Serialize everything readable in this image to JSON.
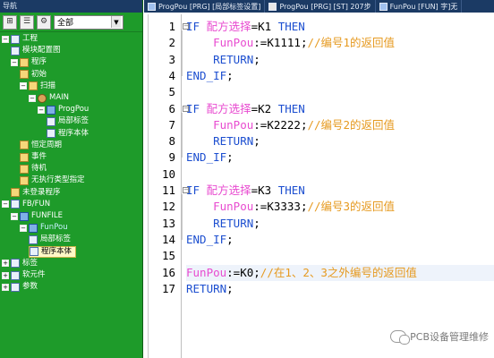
{
  "nav": {
    "title": "导航",
    "toolbar": {
      "select_value": "全部"
    },
    "tree": [
      {
        "label": "工程",
        "level": 0,
        "toggle": "-",
        "icon": "project-icon"
      },
      {
        "label": "模块配置图",
        "level": 1,
        "toggle": "",
        "icon": "module-config-icon"
      },
      {
        "label": "程序",
        "level": 1,
        "toggle": "-",
        "icon": "program-folder-icon"
      },
      {
        "label": "初始",
        "level": 2,
        "toggle": "",
        "icon": "folder-icon"
      },
      {
        "label": "扫描",
        "level": 2,
        "toggle": "-",
        "icon": "folder-icon"
      },
      {
        "label": "MAIN",
        "level": 3,
        "toggle": "-",
        "icon": "main-program-icon"
      },
      {
        "label": "ProgPou",
        "level": 4,
        "toggle": "-",
        "icon": "program-icon"
      },
      {
        "label": "局部标签",
        "level": 5,
        "toggle": "",
        "icon": "local-label-icon"
      },
      {
        "label": "程序本体",
        "level": 5,
        "toggle": "",
        "icon": "program-body-icon"
      },
      {
        "label": "恒定周期",
        "level": 2,
        "toggle": "",
        "icon": "folder-icon"
      },
      {
        "label": "事件",
        "level": 2,
        "toggle": "",
        "icon": "folder-icon"
      },
      {
        "label": "待机",
        "level": 2,
        "toggle": "",
        "icon": "folder-icon"
      },
      {
        "label": "无执行类型指定",
        "level": 2,
        "toggle": "",
        "icon": "folder-icon"
      },
      {
        "label": "未登录程序",
        "level": 1,
        "toggle": "",
        "icon": "folder-icon"
      },
      {
        "label": "FB/FUN",
        "level": 0,
        "toggle": "-",
        "icon": "fbfun-icon"
      },
      {
        "label": "FUNFILE",
        "level": 1,
        "toggle": "-",
        "icon": "funfile-icon"
      },
      {
        "label": "FunPou",
        "level": 2,
        "toggle": "-",
        "icon": "function-icon"
      },
      {
        "label": "局部标签",
        "level": 3,
        "toggle": "",
        "icon": "local-label-icon"
      },
      {
        "label": "程序本体",
        "level": 3,
        "toggle": "",
        "icon": "program-body-icon",
        "selected": true
      },
      {
        "label": "标签",
        "level": 0,
        "toggle": "+",
        "icon": "label-icon"
      },
      {
        "label": "软元件",
        "level": 0,
        "toggle": "+",
        "icon": "device-icon"
      },
      {
        "label": "参数",
        "level": 0,
        "toggle": "+",
        "icon": "parameter-icon"
      }
    ]
  },
  "tabs": [
    {
      "label": "ProgPou [PRG] [局部标签设置]",
      "icon": "local-label-tab-icon"
    },
    {
      "label": "ProgPou [PRG] [ST] 207步",
      "icon": "st-tab-icon"
    },
    {
      "label": "FunPou [FUN] 字]无",
      "icon": "fun-tab-icon"
    }
  ],
  "editor": {
    "lines": [
      {
        "n": "1",
        "tokens": [
          [
            "kw",
            "IF "
          ],
          [
            "var",
            "配方选择"
          ],
          [
            "op",
            "=K1 "
          ],
          [
            "kw",
            "THEN"
          ]
        ],
        "fold": "-"
      },
      {
        "n": "2",
        "tokens": [
          [
            "op",
            "    "
          ],
          [
            "var",
            "FunPou"
          ],
          [
            "op",
            ":=K1111;"
          ],
          [
            "cmt",
            "//编号1的返回值"
          ]
        ]
      },
      {
        "n": "3",
        "tokens": [
          [
            "op",
            "    "
          ],
          [
            "kw",
            "RETURN"
          ],
          [
            "op",
            ";"
          ]
        ]
      },
      {
        "n": "4",
        "tokens": [
          [
            "kw",
            "END_IF"
          ],
          [
            "op",
            ";"
          ]
        ],
        "fold_end": true
      },
      {
        "n": "5",
        "tokens": []
      },
      {
        "n": "6",
        "tokens": [
          [
            "kw",
            "IF "
          ],
          [
            "var",
            "配方选择"
          ],
          [
            "op",
            "=K2 "
          ],
          [
            "kw",
            "THEN"
          ]
        ],
        "fold": "-"
      },
      {
        "n": "7",
        "tokens": [
          [
            "op",
            "    "
          ],
          [
            "var",
            "FunPou"
          ],
          [
            "op",
            ":=K2222;"
          ],
          [
            "cmt",
            "//编号2的返回值"
          ]
        ]
      },
      {
        "n": "8",
        "tokens": [
          [
            "op",
            "    "
          ],
          [
            "kw",
            "RETURN"
          ],
          [
            "op",
            ";"
          ]
        ]
      },
      {
        "n": "9",
        "tokens": [
          [
            "kw",
            "END_IF"
          ],
          [
            "op",
            ";"
          ]
        ],
        "fold_end": true
      },
      {
        "n": "10",
        "tokens": []
      },
      {
        "n": "11",
        "tokens": [
          [
            "kw",
            "IF "
          ],
          [
            "var",
            "配方选择"
          ],
          [
            "op",
            "=K3 "
          ],
          [
            "kw",
            "THEN"
          ]
        ],
        "fold": "-"
      },
      {
        "n": "12",
        "tokens": [
          [
            "op",
            "    "
          ],
          [
            "var",
            "FunPou"
          ],
          [
            "op",
            ":=K3333;"
          ],
          [
            "cmt",
            "//编号3的返回值"
          ]
        ]
      },
      {
        "n": "13",
        "tokens": [
          [
            "op",
            "    "
          ],
          [
            "kw",
            "RETURN"
          ],
          [
            "op",
            ";"
          ]
        ]
      },
      {
        "n": "14",
        "tokens": [
          [
            "kw",
            "END_IF"
          ],
          [
            "op",
            ";"
          ]
        ],
        "fold_end": true
      },
      {
        "n": "15",
        "tokens": []
      },
      {
        "n": "16",
        "tokens": [
          [
            "var",
            "FunPou"
          ],
          [
            "op",
            ":=K0;"
          ],
          [
            "cmt",
            "//在1、2、3之外编号的返回值"
          ]
        ],
        "highlight": true
      },
      {
        "n": "17",
        "tokens": [
          [
            "kw",
            "RETURN"
          ],
          [
            "op",
            ";"
          ]
        ]
      }
    ]
  },
  "watermark": {
    "text": "PCB设备管理维修"
  },
  "colors": {
    "nav_bg": "#1e9b2a",
    "keyword": "#1d4fd0",
    "variable": "#e84bd0",
    "comment": "#e69a20",
    "title_bar": "#1b3a64"
  }
}
